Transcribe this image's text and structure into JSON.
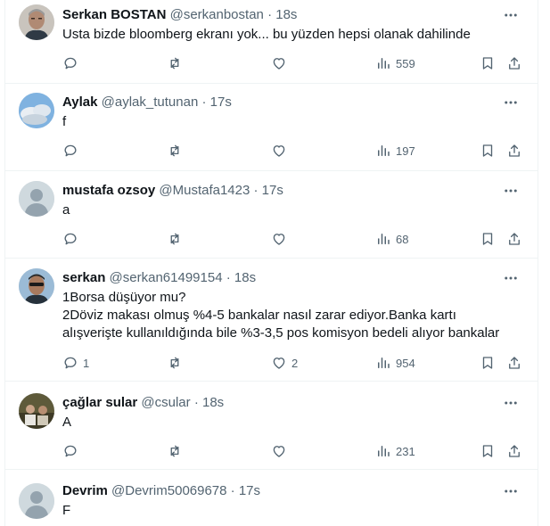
{
  "tweets": [
    {
      "name": "Serkan BOSTAN",
      "handle": "@serkanbostan",
      "time": "18s",
      "lines": [
        "Usta bizde bloomberg ekranı yok... bu yüzden hepsi olanak dahilinde"
      ],
      "replies": "",
      "retweets": "",
      "likes": "",
      "views": "559",
      "avatar": "man-gray-hair"
    },
    {
      "name": "Aylak",
      "handle": "@aylak_tutunan",
      "time": "17s",
      "lines": [
        "f"
      ],
      "replies": "",
      "retweets": "",
      "likes": "",
      "views": "197",
      "avatar": "sky-clouds"
    },
    {
      "name": "mustafa ozsoy",
      "handle": "@Mustafa1423",
      "time": "17s",
      "lines": [
        "a"
      ],
      "replies": "",
      "retweets": "",
      "likes": "",
      "views": "68",
      "avatar": "default-person"
    },
    {
      "name": "serkan",
      "handle": "@serkan61499154",
      "time": "18s",
      "lines": [
        "1Borsa düşüyor mu?",
        "2Döviz makası olmuş %4-5 bankalar nasıl zarar ediyor.Banka kartı",
        "alışverişte kullanıldığında bile %3-3,5 pos komisyon bedeli alıyor bankalar"
      ],
      "replies": "1",
      "retweets": "",
      "likes": "2",
      "views": "954",
      "avatar": "man-sunglasses"
    },
    {
      "name": "çağlar sular",
      "handle": "@csular",
      "time": "18s",
      "lines": [
        "A"
      ],
      "replies": "",
      "retweets": "",
      "likes": "",
      "views": "231",
      "avatar": "group-photo"
    },
    {
      "name": "Devrim",
      "handle": "@Devrim50069678",
      "time": "17s",
      "lines": [
        "F"
      ],
      "replies": "",
      "retweets": "",
      "likes": "",
      "views": "",
      "avatar": "default-person"
    }
  ],
  "separator": "·",
  "colors": {
    "text": "#0f1419",
    "secondary": "#536471",
    "border": "#eff3f4",
    "default_avatar_bg": "#cfd9de"
  }
}
